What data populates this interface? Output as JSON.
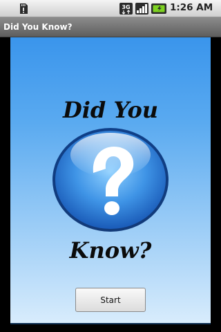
{
  "status_bar": {
    "time": "1:26 AM",
    "network_label": "3G",
    "icons": [
      "sd-card-icon",
      "3g-network-icon",
      "signal-icon",
      "battery-icon"
    ]
  },
  "app": {
    "title": "Did You Know?"
  },
  "main": {
    "heading_line1": "Did You",
    "heading_line2": "Know?",
    "center_icon": "question-mark-icon",
    "start_label": "Start"
  },
  "colors": {
    "background_top": "#3a95ec",
    "background_bottom": "#d8ecfc",
    "title_bar": "#6e6e6e",
    "orb_blue": "#2a7ad5"
  }
}
